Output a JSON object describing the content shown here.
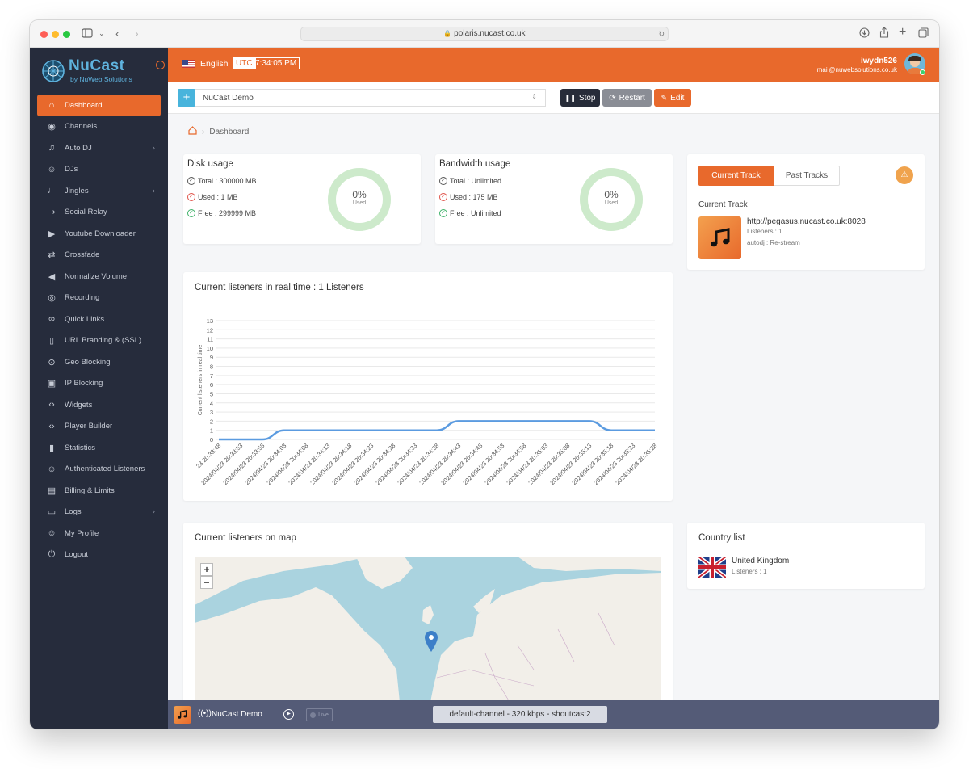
{
  "browser": {
    "url": "polaris.nucast.co.uk"
  },
  "logo": {
    "name": "NuCast",
    "subtitle": "by NuWeb Solutions"
  },
  "sidebar": {
    "items": [
      {
        "label": "Dashboard",
        "icon": "home-icon"
      },
      {
        "label": "Channels",
        "icon": "broadcast-icon"
      },
      {
        "label": "Auto DJ",
        "icon": "music-note-icon"
      },
      {
        "label": "DJs",
        "icon": "user-plus-icon"
      },
      {
        "label": "Jingles",
        "icon": "bell-icon"
      },
      {
        "label": "Social Relay",
        "icon": "share-icon"
      },
      {
        "label": "Youtube Downloader",
        "icon": "play-box-icon"
      },
      {
        "label": "Crossfade",
        "icon": "repeat-icon"
      },
      {
        "label": "Normalize Volume",
        "icon": "volume-icon"
      },
      {
        "label": "Recording",
        "icon": "target-icon"
      },
      {
        "label": "Quick Links",
        "icon": "link-icon"
      },
      {
        "label": "URL Branding & (SSL)",
        "icon": "bookmark-icon"
      },
      {
        "label": "Geo Blocking",
        "icon": "map-pin-icon"
      },
      {
        "label": "IP Blocking",
        "icon": "lock-icon"
      },
      {
        "label": "Widgets",
        "icon": "code-icon"
      },
      {
        "label": "Player Builder",
        "icon": "code-icon"
      },
      {
        "label": "Statistics",
        "icon": "bar-chart-icon"
      },
      {
        "label": "Authenticated Listeners",
        "icon": "user-check-icon"
      },
      {
        "label": "Billing & Limits",
        "icon": "file-icon"
      },
      {
        "label": "Logs",
        "icon": "folder-icon"
      },
      {
        "label": "My Profile",
        "icon": "user-icon"
      },
      {
        "label": "Logout",
        "icon": "power-icon"
      }
    ]
  },
  "topbar": {
    "language": "English",
    "timezone": "UTC",
    "time": "7:34:05 PM",
    "username": "iwydn526",
    "email": "mail@nuwebsolutions.co.uk"
  },
  "controls": {
    "add": "+",
    "channel": "NuCast Demo",
    "stop": "Stop",
    "restart": "Restart",
    "edit": "Edit"
  },
  "breadcrumb": {
    "current": "Dashboard"
  },
  "disk": {
    "title": "Disk usage",
    "total": "Total : 300000 MB",
    "used": "Used : 1 MB",
    "free": "Free : 299999 MB",
    "percent": "0%",
    "percent_label": "Used"
  },
  "bandwidth": {
    "title": "Bandwidth usage",
    "total": "Total : Unlimited",
    "used": "Used : 175 MB",
    "free": "Free : Unlimited",
    "percent": "0%",
    "percent_label": "Used"
  },
  "track": {
    "tab_current": "Current Track",
    "tab_past": "Past Tracks",
    "heading": "Current Track",
    "url": "http://pegasus.nucast.co.uk:8028",
    "listeners": "Listeners : 1",
    "autodj": "autodj : Re-stream"
  },
  "listeners_card": {
    "title": "Current listeners in real time : 1 Listeners"
  },
  "map_card": {
    "title": "Current listeners on map",
    "zoom_in": "+",
    "zoom_out": "−"
  },
  "country_card": {
    "title": "Country list",
    "country": "United Kingdom",
    "listeners": "Listeners : 1"
  },
  "player": {
    "name": "NuCast Demo",
    "live": "Live",
    "stream": "default-channel - 320 kbps - shoutcast2"
  },
  "colors": {
    "accent": "#e8692c",
    "sidebar": "#262c3c",
    "line": "#5b9be0",
    "donut": "#cdeacb"
  },
  "chart_data": {
    "type": "line",
    "ylabel": "Current listeners in real time",
    "ylim": [
      0,
      13
    ],
    "yticks": [
      0,
      1,
      2,
      3,
      4,
      5,
      6,
      7,
      8,
      9,
      10,
      11,
      12,
      13
    ],
    "x": [
      "2024/04/23 20:33:48",
      "2024/04/23 20:33:53",
      "2024/04/23 20:33:58",
      "2024/04/23 20:34:03",
      "2024/04/23 20:34:08",
      "2024/04/23 20:34:13",
      "2024/04/23 20:34:18",
      "2024/04/23 20:34:23",
      "2024/04/23 20:34:28",
      "2024/04/23 20:34:33",
      "2024/04/23 20:34:38",
      "2024/04/23 20:34:43",
      "2024/04/23 20:34:48",
      "2024/04/23 20:34:53",
      "2024/04/23 20:34:58",
      "2024/04/23 20:35:03",
      "2024/04/23 20:35:08",
      "2024/04/23 20:35:13",
      "2024/04/23 20:35:18",
      "2024/04/23 20:35:23",
      "2024/04/23 20:35:28"
    ],
    "xtick_labels": [
      "23 20:33:48",
      "2024/04/23 20:33:53",
      "2024/04/23 20:33:58",
      "2024/04/23 20:34:03",
      "2024/04/23 20:34:08",
      "2024/04/23 20:34:13",
      "2024/04/23 20:34:18",
      "2024/04/23 20:34:23",
      "2024/04/23 20:34:28",
      "2024/04/23 20:34:33",
      "2024/04/23 20:34:38",
      "2024/04/23 20:34:43",
      "2024/04/23 20:34:48",
      "2024/04/23 20:34:53",
      "2024/04/23 20:34:58",
      "2024/04/23 20:35:03",
      "2024/04/23 20:35:08",
      "2024/04/23 20:35:13",
      "2024/04/23 20:35:18",
      "2024/04/23 20:35:23",
      "2024/04/23 20:35:28"
    ],
    "series": [
      {
        "values": [
          0,
          0,
          0,
          1,
          1,
          1,
          1,
          1,
          1,
          1,
          1,
          2,
          2,
          2,
          2,
          2,
          2,
          2,
          1,
          1,
          1
        ]
      }
    ],
    "grid": true
  }
}
